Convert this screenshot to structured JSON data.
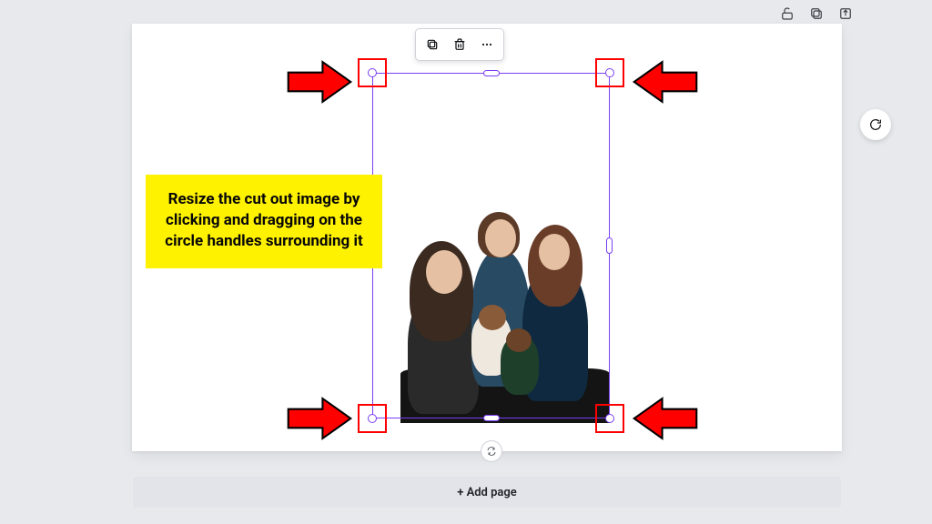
{
  "toolbar": {
    "copy_tip": "Duplicate",
    "delete_tip": "Delete",
    "more_tip": "More"
  },
  "top_icons": {
    "lock_tip": "Lock",
    "copy_tip": "Duplicate page",
    "share_tip": "Share"
  },
  "note": {
    "text": "Resize the cut out image by clicking and dragging on the circle handles surrounding it"
  },
  "add_page_label": "+ Add page",
  "colors": {
    "selection": "#7a3ff2",
    "highlight": "#ff0000",
    "note_bg": "#fff200",
    "arrow": "#ff0000"
  }
}
